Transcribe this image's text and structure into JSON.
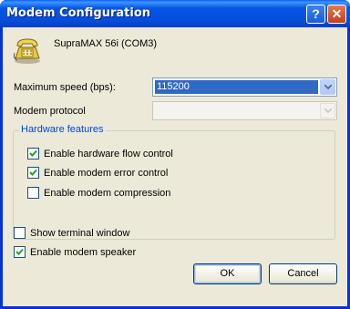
{
  "window": {
    "title": "Modem Configuration",
    "help_label": "?",
    "close_label": "✕"
  },
  "device": {
    "icon": "modem-phone-icon",
    "name": "SupraMAX 56i (COM3)"
  },
  "max_speed": {
    "label": "Maximum speed (bps):",
    "value": "115200"
  },
  "protocol": {
    "label": "Modem protocol",
    "value": "",
    "enabled": false
  },
  "hardware": {
    "title": "Hardware features",
    "items": [
      {
        "label": "Enable hardware flow control",
        "checked": true
      },
      {
        "label": "Enable modem error control",
        "checked": true
      },
      {
        "label": "Enable modem compression",
        "checked": false
      }
    ]
  },
  "options": [
    {
      "label": "Show terminal window",
      "checked": false
    },
    {
      "label": "Enable modem speaker",
      "checked": true
    }
  ],
  "buttons": {
    "ok": "OK",
    "cancel": "Cancel"
  },
  "colors": {
    "titlebar": "#0854e3",
    "selection": "#316ac5",
    "group_title": "#0046d5",
    "dialog_bg": "#ece9d8"
  }
}
